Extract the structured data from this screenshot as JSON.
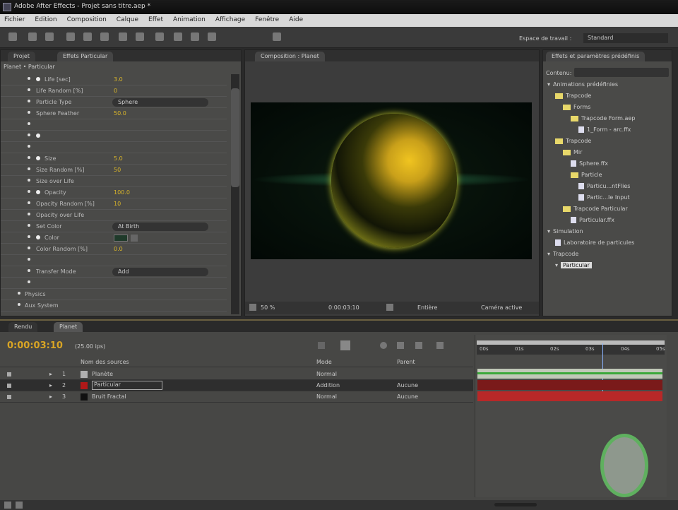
{
  "window": {
    "title": "Adobe After Effects - Projet sans titre.aep *"
  },
  "menu": [
    "Fichier",
    "Edition",
    "Composition",
    "Calque",
    "Effet",
    "Animation",
    "Affichage",
    "Fenêtre",
    "Aide"
  ],
  "workspace": {
    "label": "Espace de travail :",
    "value": "Standard"
  },
  "left_panel": {
    "tabs": [
      "Projet",
      "Effets Particular"
    ],
    "breadcrumb": "Planet • Particular",
    "properties": [
      {
        "label": "Life [sec]",
        "value": "3.0",
        "stopwatch": true
      },
      {
        "label": "Life Random [%]",
        "value": "0"
      },
      {
        "label": "Particle Type",
        "dropdown": "Sphere"
      },
      {
        "label": "Sphere Feather",
        "value": "50.0"
      },
      {
        "label": "",
        "value": ""
      },
      {
        "label": "",
        "value": "",
        "stopwatch": true
      },
      {
        "label": "",
        "value": ""
      },
      {
        "label": "Size",
        "value": "5.0",
        "stopwatch": true
      },
      {
        "label": "Size Random [%]",
        "value": "50"
      },
      {
        "label": "Size over Life",
        "value": ""
      },
      {
        "label": "Opacity",
        "value": "100.0",
        "stopwatch": true
      },
      {
        "label": "Opacity Random [%]",
        "value": "10"
      },
      {
        "label": "Opacity over Life",
        "value": ""
      },
      {
        "label": "Set Color",
        "dropdown": "At Birth"
      },
      {
        "label": "Color",
        "swatch": "#1f3a2a",
        "stopwatch": true
      },
      {
        "label": "Color Random [%]",
        "value": "0.0"
      },
      {
        "label": "",
        "value": ""
      },
      {
        "label": "Transfer Mode",
        "dropdown": "Add"
      },
      {
        "label": "",
        "value": ""
      }
    ],
    "sections": [
      "Physics",
      "Aux System"
    ]
  },
  "viewer": {
    "tab": "Composition : Planet",
    "zoom": "50 %",
    "timecode": "0:00:03:10",
    "resolution": "Entière",
    "camera": "Caméra active"
  },
  "right_panel": {
    "title": "Effets et paramètres prédéfinis",
    "search_label": "Contenu:",
    "tree": [
      {
        "label": "Animations prédéfinies",
        "type": "root",
        "depth": 0
      },
      {
        "label": "Trapcode",
        "type": "folder",
        "depth": 1
      },
      {
        "label": "Forms",
        "type": "folder",
        "depth": 2
      },
      {
        "label": "Trapcode Form.aep",
        "type": "folder",
        "depth": 3
      },
      {
        "label": "1_Form - arc.ffx",
        "type": "file",
        "depth": 4
      },
      {
        "label": "Trapcode",
        "type": "folder",
        "depth": 1
      },
      {
        "label": "Mir",
        "type": "folder",
        "depth": 2
      },
      {
        "label": "Sphere.ffx",
        "type": "file",
        "depth": 3
      },
      {
        "label": "Particle",
        "type": "folder",
        "depth": 3
      },
      {
        "label": "Particu...ntFlies",
        "type": "file",
        "depth": 4
      },
      {
        "label": "Partic...Ie Input",
        "type": "file",
        "depth": 4
      },
      {
        "label": "Trapcode Particular",
        "type": "folder",
        "depth": 2
      },
      {
        "label": "Particular.ffx",
        "type": "file",
        "depth": 3
      },
      {
        "label": "Simulation",
        "type": "root",
        "depth": 0
      },
      {
        "label": "Laboratoire de particules",
        "type": "file",
        "depth": 1
      },
      {
        "label": "Trapcode",
        "type": "root",
        "depth": 0
      },
      {
        "label": "Particular",
        "type": "selected",
        "depth": 1
      }
    ]
  },
  "timeline": {
    "tabs": [
      "Rendu",
      "Planet"
    ],
    "timecode": "0:00:03:10",
    "fps": "(25.00 ips)",
    "columns": {
      "name": "Nom des sources",
      "mode": "Mode",
      "parent": "Parent"
    },
    "layers": [
      {
        "num": "1",
        "name": "Planète",
        "mode": "Normal",
        "parent": "",
        "color": "#b0b0b0",
        "bar": "#c0c8b8"
      },
      {
        "num": "2",
        "name": "Particular",
        "mode": "Addition",
        "parent": "Aucune",
        "color": "#b01818",
        "bar": "#7a1a1a"
      },
      {
        "num": "3",
        "name": "Bruit Fractal",
        "mode": "Normal",
        "parent": "Aucune",
        "color": "#111111",
        "bar": "#b82828"
      }
    ],
    "ruler": [
      "00s",
      "01s",
      "02s",
      "03s",
      "04s",
      "05s"
    ],
    "playhead_fraction": 0.67
  }
}
